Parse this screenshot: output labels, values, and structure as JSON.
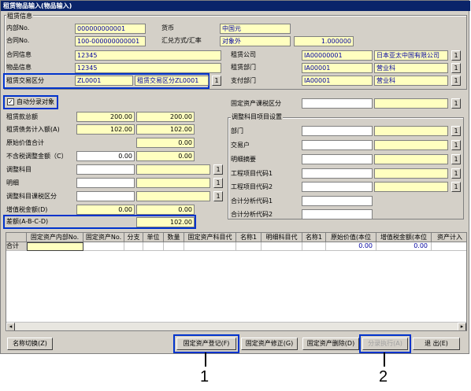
{
  "title": "租赁物品输入(物品输入)",
  "lease_info": {
    "group_label": "租赁信息",
    "internal_no_label": "内部No.",
    "internal_no_value": "000000000001",
    "currency_label": "货币",
    "currency_value": "中国元",
    "contract_no_label": "合同No.",
    "contract_no_value": "100-000000000001",
    "exchange_label": "汇兑方式/汇率",
    "exchange_mode": "对象外",
    "exchange_rate": "1.000000",
    "contract_info_label": "合同信息",
    "contract_info_value": "12345",
    "item_info_label": "物品信息",
    "item_info_value": "12345",
    "lease_company_label": "租赁公司",
    "lease_company_code": "IA00000001",
    "lease_company_name": "日本亚太中国有限公司",
    "lease_dept_label": "租赁部门",
    "lease_dept_code": "IA00001",
    "lease_dept_name": "营业科",
    "trade_type_label": "租赁交易区分",
    "trade_type_code": "ZL0001",
    "trade_type_name": "租赁交易区分ZL0001",
    "pay_dept_label": "支付部门",
    "pay_dept_code": "IA00001",
    "pay_dept_name": "营业科",
    "btn_glyph": "1"
  },
  "auto_entry": {
    "checked": true,
    "check_mark": "✓",
    "label": "自动分录对象"
  },
  "amounts": {
    "lease_total_label": "租赁款总额",
    "lease_total_a": "200.00",
    "lease_total_b": "200.00",
    "lease_debt_label": "租赁债务计入额(A)",
    "lease_debt_a": "102.00",
    "lease_debt_b": "102.00",
    "original_price_label": "原始价值合计",
    "original_price": "0.00",
    "nontax_adj_label": "不含税调整金额（C）",
    "nontax_adj_a": "0.00",
    "nontax_adj_b": "0.00",
    "adj_subject_label": "调整科目",
    "detail_label": "明细",
    "adj_tax_label": "调整科目课税区分",
    "vat_label": "增值税金额(D)",
    "vat_a": "0.00",
    "vat_b": "0.00",
    "diff_label": "差额(A-B-C-D)",
    "diff_value": "102.00"
  },
  "right_panel": {
    "fa_tax_label": "固定资产课税区分",
    "adj_group_label": "调整科目项目设置",
    "dept_label": "部门",
    "trade_party_label": "交易户",
    "detail_summary_label": "明细摘要",
    "project1_label": "工程项目代码1",
    "project2_label": "工程项目代码2",
    "analysis1_label": "合计分析代码1",
    "analysis2_label": "合计分析代码2"
  },
  "grid": {
    "columns": [
      "固定资产内部No.",
      "固定资产No.",
      "分支",
      "单位",
      "数量",
      "固定资产科目代",
      "名称1",
      "明细科目代",
      "名称1",
      "原始价值(本位",
      "增值税金额(本位",
      "资产计入"
    ],
    "total_row_label": "合计",
    "total_original": "0.00",
    "total_vat": "0.00"
  },
  "buttons": {
    "name_switch": "名称切换(Z)",
    "fa_register": "固定资产登记(F)",
    "fa_modify": "固定资产修正(G)",
    "fa_delete": "固定资产删除(D)",
    "entry_execute": "分录执行(A)",
    "exit": "退 出(E)"
  },
  "callouts": {
    "one": "1",
    "two": "2"
  },
  "colors": {
    "titlebar": "#0a246a",
    "highlight": "#0033cc",
    "field_yellow": "#ffffc0",
    "window_bg": "#d4d0c8"
  }
}
